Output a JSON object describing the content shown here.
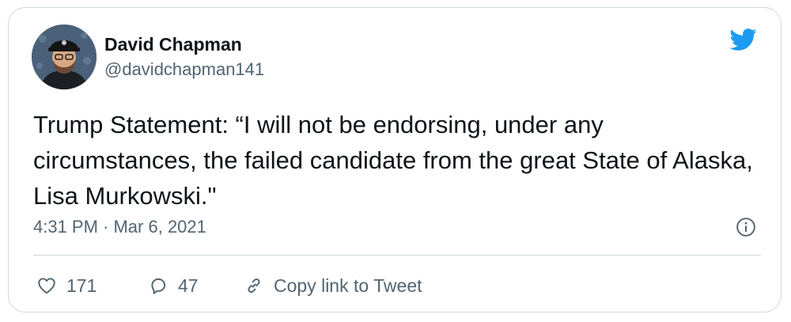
{
  "tweet": {
    "author_name": "David Chapman",
    "author_handle": "@davidchapman141",
    "text": "Trump Statement: “I will not be endorsing, under any circumstances, the failed candidate from the great State of Alaska, Lisa Murkowski.\"",
    "timestamp": "4:31 PM · Mar 6, 2021",
    "likes": "171",
    "replies": "47",
    "copy_link_label": "Copy link to Tweet"
  },
  "icons": {
    "brand": "twitter-bird-icon",
    "info": "info-icon",
    "like": "heart-icon",
    "reply": "reply-bubble-icon",
    "link": "link-icon"
  },
  "colors": {
    "brand_blue": "#1d9bf0",
    "text_primary": "#0f1419",
    "text_secondary": "#536471",
    "border": "#cfd9de"
  }
}
